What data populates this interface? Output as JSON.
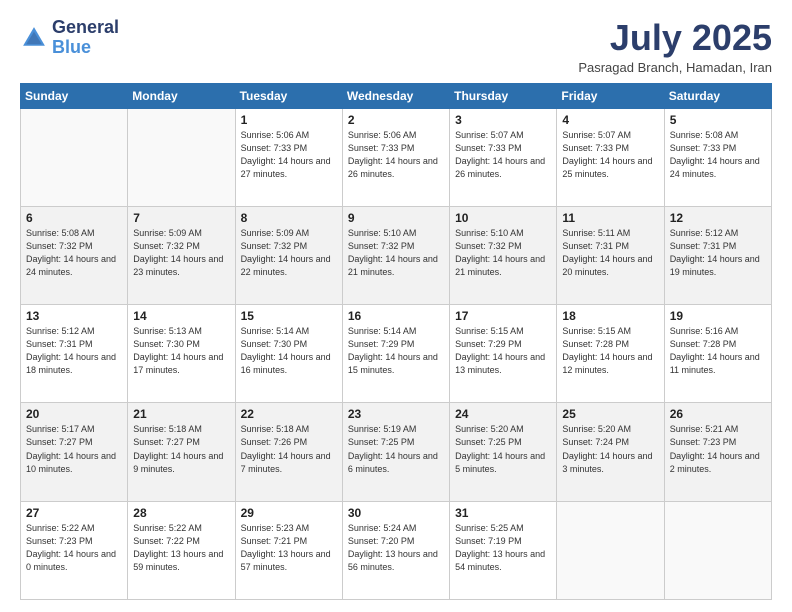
{
  "logo": {
    "line1": "General",
    "line2": "Blue"
  },
  "title": "July 2025",
  "location": "Pasragad Branch, Hamadan, Iran",
  "days_of_week": [
    "Sunday",
    "Monday",
    "Tuesday",
    "Wednesday",
    "Thursday",
    "Friday",
    "Saturday"
  ],
  "weeks": [
    [
      {
        "day": "",
        "info": ""
      },
      {
        "day": "",
        "info": ""
      },
      {
        "day": "1",
        "info": "Sunrise: 5:06 AM\nSunset: 7:33 PM\nDaylight: 14 hours and 27 minutes."
      },
      {
        "day": "2",
        "info": "Sunrise: 5:06 AM\nSunset: 7:33 PM\nDaylight: 14 hours and 26 minutes."
      },
      {
        "day": "3",
        "info": "Sunrise: 5:07 AM\nSunset: 7:33 PM\nDaylight: 14 hours and 26 minutes."
      },
      {
        "day": "4",
        "info": "Sunrise: 5:07 AM\nSunset: 7:33 PM\nDaylight: 14 hours and 25 minutes."
      },
      {
        "day": "5",
        "info": "Sunrise: 5:08 AM\nSunset: 7:33 PM\nDaylight: 14 hours and 24 minutes."
      }
    ],
    [
      {
        "day": "6",
        "info": "Sunrise: 5:08 AM\nSunset: 7:32 PM\nDaylight: 14 hours and 24 minutes."
      },
      {
        "day": "7",
        "info": "Sunrise: 5:09 AM\nSunset: 7:32 PM\nDaylight: 14 hours and 23 minutes."
      },
      {
        "day": "8",
        "info": "Sunrise: 5:09 AM\nSunset: 7:32 PM\nDaylight: 14 hours and 22 minutes."
      },
      {
        "day": "9",
        "info": "Sunrise: 5:10 AM\nSunset: 7:32 PM\nDaylight: 14 hours and 21 minutes."
      },
      {
        "day": "10",
        "info": "Sunrise: 5:10 AM\nSunset: 7:32 PM\nDaylight: 14 hours and 21 minutes."
      },
      {
        "day": "11",
        "info": "Sunrise: 5:11 AM\nSunset: 7:31 PM\nDaylight: 14 hours and 20 minutes."
      },
      {
        "day": "12",
        "info": "Sunrise: 5:12 AM\nSunset: 7:31 PM\nDaylight: 14 hours and 19 minutes."
      }
    ],
    [
      {
        "day": "13",
        "info": "Sunrise: 5:12 AM\nSunset: 7:31 PM\nDaylight: 14 hours and 18 minutes."
      },
      {
        "day": "14",
        "info": "Sunrise: 5:13 AM\nSunset: 7:30 PM\nDaylight: 14 hours and 17 minutes."
      },
      {
        "day": "15",
        "info": "Sunrise: 5:14 AM\nSunset: 7:30 PM\nDaylight: 14 hours and 16 minutes."
      },
      {
        "day": "16",
        "info": "Sunrise: 5:14 AM\nSunset: 7:29 PM\nDaylight: 14 hours and 15 minutes."
      },
      {
        "day": "17",
        "info": "Sunrise: 5:15 AM\nSunset: 7:29 PM\nDaylight: 14 hours and 13 minutes."
      },
      {
        "day": "18",
        "info": "Sunrise: 5:15 AM\nSunset: 7:28 PM\nDaylight: 14 hours and 12 minutes."
      },
      {
        "day": "19",
        "info": "Sunrise: 5:16 AM\nSunset: 7:28 PM\nDaylight: 14 hours and 11 minutes."
      }
    ],
    [
      {
        "day": "20",
        "info": "Sunrise: 5:17 AM\nSunset: 7:27 PM\nDaylight: 14 hours and 10 minutes."
      },
      {
        "day": "21",
        "info": "Sunrise: 5:18 AM\nSunset: 7:27 PM\nDaylight: 14 hours and 9 minutes."
      },
      {
        "day": "22",
        "info": "Sunrise: 5:18 AM\nSunset: 7:26 PM\nDaylight: 14 hours and 7 minutes."
      },
      {
        "day": "23",
        "info": "Sunrise: 5:19 AM\nSunset: 7:25 PM\nDaylight: 14 hours and 6 minutes."
      },
      {
        "day": "24",
        "info": "Sunrise: 5:20 AM\nSunset: 7:25 PM\nDaylight: 14 hours and 5 minutes."
      },
      {
        "day": "25",
        "info": "Sunrise: 5:20 AM\nSunset: 7:24 PM\nDaylight: 14 hours and 3 minutes."
      },
      {
        "day": "26",
        "info": "Sunrise: 5:21 AM\nSunset: 7:23 PM\nDaylight: 14 hours and 2 minutes."
      }
    ],
    [
      {
        "day": "27",
        "info": "Sunrise: 5:22 AM\nSunset: 7:23 PM\nDaylight: 14 hours and 0 minutes."
      },
      {
        "day": "28",
        "info": "Sunrise: 5:22 AM\nSunset: 7:22 PM\nDaylight: 13 hours and 59 minutes."
      },
      {
        "day": "29",
        "info": "Sunrise: 5:23 AM\nSunset: 7:21 PM\nDaylight: 13 hours and 57 minutes."
      },
      {
        "day": "30",
        "info": "Sunrise: 5:24 AM\nSunset: 7:20 PM\nDaylight: 13 hours and 56 minutes."
      },
      {
        "day": "31",
        "info": "Sunrise: 5:25 AM\nSunset: 7:19 PM\nDaylight: 13 hours and 54 minutes."
      },
      {
        "day": "",
        "info": ""
      },
      {
        "day": "",
        "info": ""
      }
    ]
  ]
}
